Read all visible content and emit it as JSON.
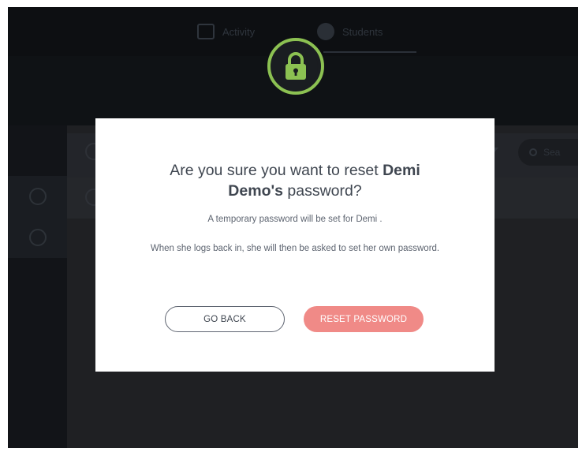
{
  "nav": {
    "tabs": [
      {
        "label": "Activity"
      },
      {
        "label": "Students"
      }
    ]
  },
  "search": {
    "placeholder": "Sea"
  },
  "dialog": {
    "title_prefix": "Are you sure you want to reset ",
    "title_name": "Demi Demo's",
    "title_suffix": " password?",
    "line1": "A temporary password will be set for Demi .",
    "line2": "When she logs back in, she will then be asked to set her own password.",
    "go_back_label": "GO BACK",
    "reset_label": "RESET PASSWORD"
  },
  "colors": {
    "accent_green": "#8cc152",
    "reset_button": "#f08a87",
    "overlay_dark": "#15171a"
  },
  "icons": {
    "badge": "lock-icon"
  }
}
